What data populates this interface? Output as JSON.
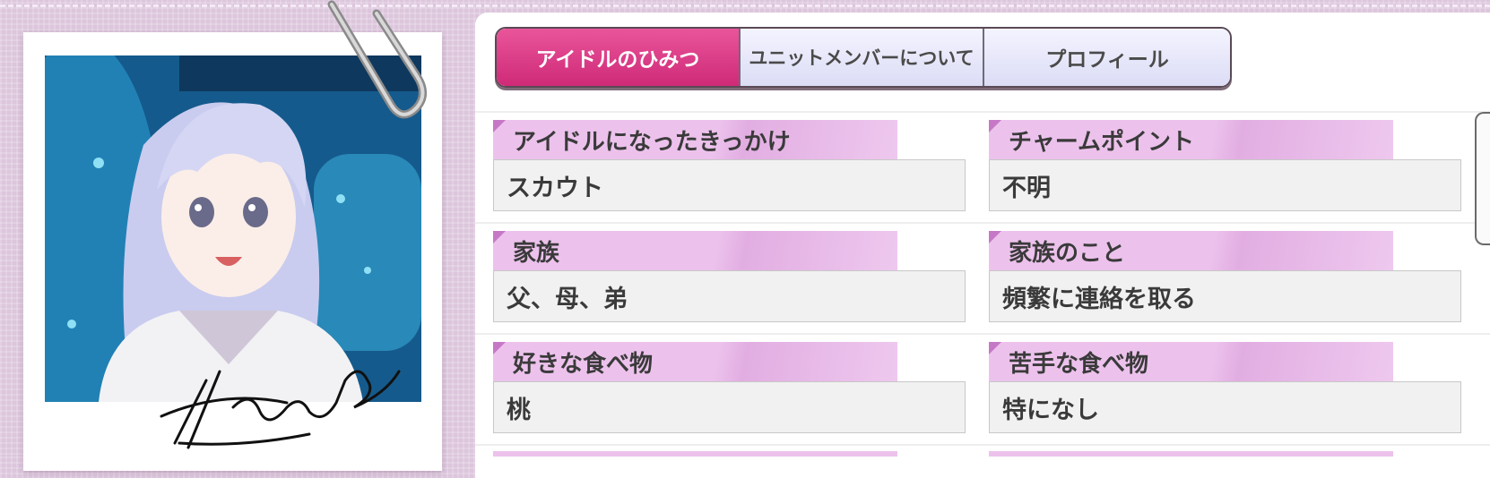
{
  "tabs": [
    {
      "label": "アイドルのひみつ",
      "active": true
    },
    {
      "label": "ユニットメンバーについて",
      "active": false
    },
    {
      "label": "プロフィール",
      "active": false
    }
  ],
  "fields": {
    "left": [
      {
        "label": "アイドルになったきっかけ",
        "value": "スカウト"
      },
      {
        "label": "家族",
        "value": "父、母、弟"
      },
      {
        "label": "好きな食べ物",
        "value": "桃"
      }
    ],
    "right": [
      {
        "label": "チャームポイント",
        "value": "不明"
      },
      {
        "label": "家族のこと",
        "value": "頻繁に連絡を取る"
      },
      {
        "label": "苦手な食べ物",
        "value": "特になし"
      }
    ]
  },
  "signature": "Haru",
  "colors": {
    "accent": "#d6317e",
    "header": "#ecc2ec",
    "background": "#dcc6dc"
  },
  "icons": {
    "paperclip": "paperclip-icon"
  }
}
